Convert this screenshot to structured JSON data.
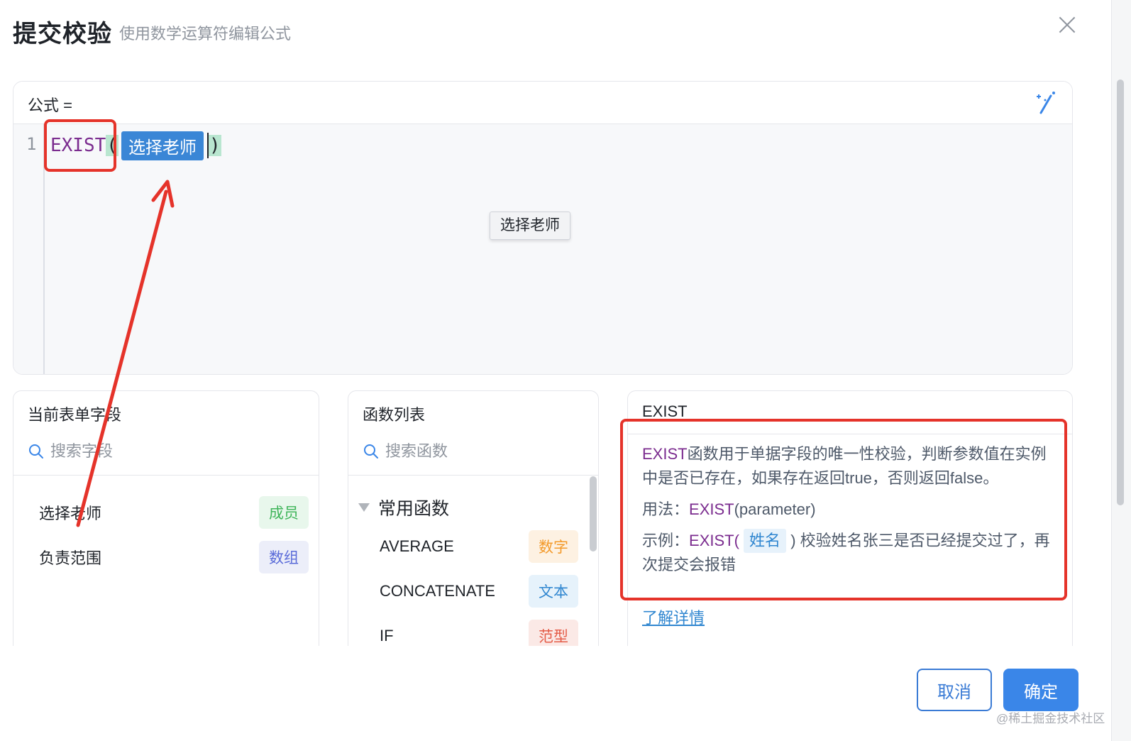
{
  "dialog": {
    "title": "提交校验",
    "subtitle": "使用数学运算符编辑公式"
  },
  "formula": {
    "label": "公式 =",
    "line_number": "1",
    "function_name": "EXIST",
    "open_paren": "(",
    "field_chip": "选择老师",
    "close_paren": ")",
    "tooltip": "选择老师"
  },
  "fields_panel": {
    "title": "当前表单字段",
    "search_placeholder": "搜索字段",
    "items": [
      {
        "label": "选择老师",
        "tag": "成员"
      },
      {
        "label": "负责范围",
        "tag": "数组"
      }
    ]
  },
  "functions_panel": {
    "title": "函数列表",
    "search_placeholder": "搜索函数",
    "group": "常用函数",
    "items": [
      {
        "label": "AVERAGE",
        "tag": "数字"
      },
      {
        "label": "CONCATENATE",
        "tag": "文本"
      },
      {
        "label": "IF",
        "tag": "范型"
      }
    ]
  },
  "description_panel": {
    "title": "EXIST",
    "kw": "EXIST",
    "desc_rest": "函数用于单据字段的唯一性校验，判断参数值在实例中是否已存在，如果存在返回true，否则返回false。",
    "usage_label": "用法：",
    "usage_fn": "EXIST",
    "usage_args": "(parameter)",
    "example_label": "示例：",
    "example_fn": "EXIST(",
    "example_chip": "姓名",
    "example_rest": ") 校验姓名张三是否已经提交过了，再次提交会报错",
    "learn_more": "了解详情"
  },
  "footer": {
    "cancel": "取消",
    "ok": "确定"
  },
  "watermark": "@稀土掘金技术社区",
  "colors": {
    "accent": "#3a86e8",
    "annotation": "#e5332a",
    "function_keyword": "#7b2c8f"
  }
}
